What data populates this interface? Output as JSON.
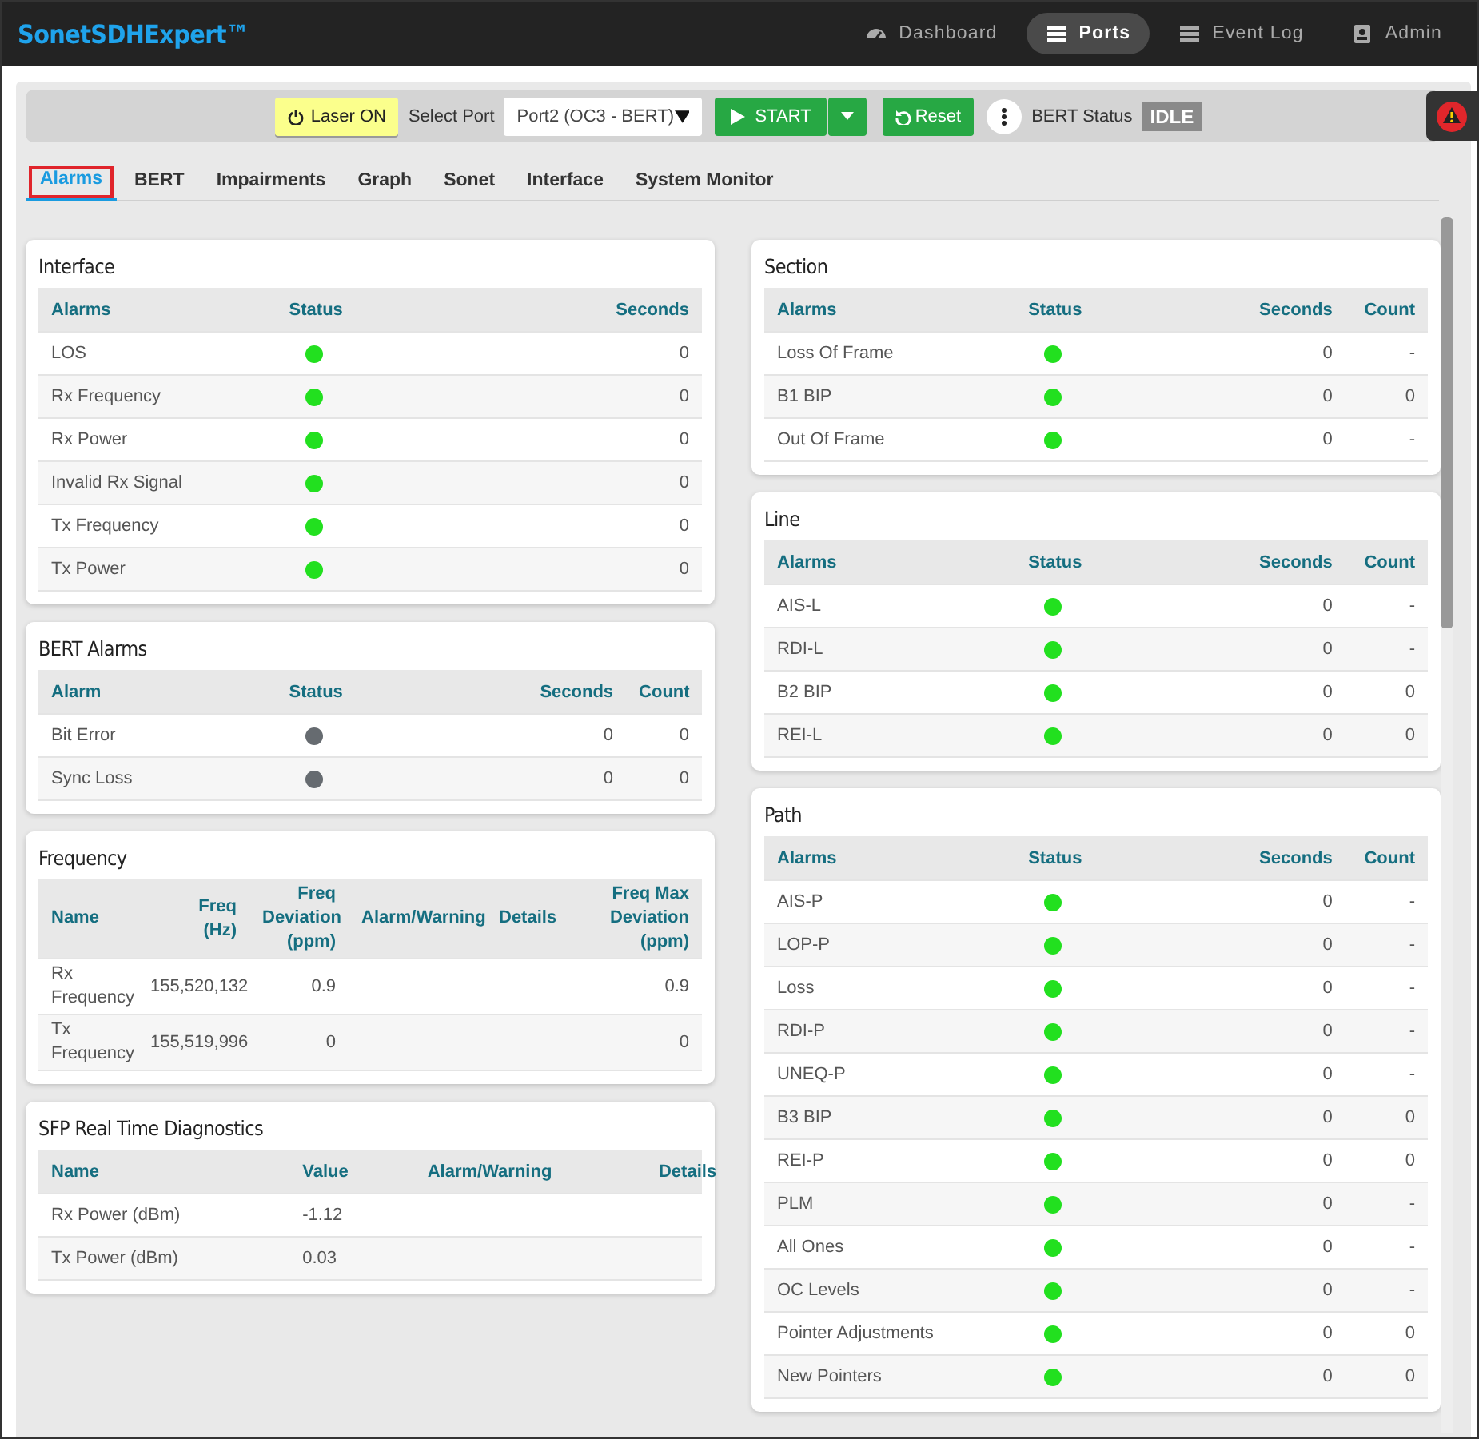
{
  "app": {
    "title": "SonetSDHExpert™"
  },
  "nav": [
    {
      "label": "Dashboard",
      "selected": false
    },
    {
      "label": "Ports",
      "selected": true
    },
    {
      "label": "Event Log",
      "selected": false
    },
    {
      "label": "Admin",
      "selected": false
    }
  ],
  "toolbar": {
    "laser_button": "Laser ON",
    "select_label": "Select Port",
    "port_select": "Port2 (OC3 - BERT)",
    "start_button": "START",
    "reset_button": "Reset",
    "status_label": "BERT Status",
    "status_value": "IDLE"
  },
  "tabs": [
    {
      "label": "Alarms",
      "selected": true
    },
    {
      "label": "BERT",
      "selected": false
    },
    {
      "label": "Impairments",
      "selected": false
    },
    {
      "label": "Graph",
      "selected": false
    },
    {
      "label": "Sonet",
      "selected": false
    },
    {
      "label": "Interface",
      "selected": false
    },
    {
      "label": "System Monitor",
      "selected": false
    }
  ],
  "left_column": [
    {
      "title": "Interface",
      "kind": "alarms3",
      "columns": [
        "Alarms",
        "Status",
        "Seconds"
      ],
      "rows": [
        {
          "name": "LOS",
          "color": "#22e01f",
          "seconds": "0"
        },
        {
          "name": "Rx Frequency",
          "color": "#22e01f",
          "seconds": "0"
        },
        {
          "name": "Rx Power",
          "color": "#22e01f",
          "seconds": "0"
        },
        {
          "name": "Invalid Rx Signal",
          "color": "#22e01f",
          "seconds": "0"
        },
        {
          "name": "Tx Frequency",
          "color": "#22e01f",
          "seconds": "0"
        },
        {
          "name": "Tx Power",
          "color": "#22e01f",
          "seconds": "0"
        }
      ]
    },
    {
      "title": "BERT Alarms",
      "kind": "alarms4",
      "columns": [
        "Alarm",
        "Status",
        "Seconds",
        "Count"
      ],
      "rows": [
        {
          "name": "Bit Error",
          "color": "#666b70",
          "seconds": "0",
          "count": "0"
        },
        {
          "name": "Sync Loss",
          "color": "#666b70",
          "seconds": "0",
          "count": "0"
        }
      ]
    },
    {
      "title": "Frequency",
      "kind": "frequency",
      "columns": [
        "Name",
        "Freq (Hz)",
        "Freq Deviation (ppm)",
        "Alarm/Warning",
        "Details",
        "Freq Max Deviation (ppm)"
      ],
      "rows": [
        {
          "name": "Rx Frequency",
          "freq": "155,520,132",
          "deviation": "0.9",
          "max_deviation": "0.9"
        },
        {
          "name": "Tx Frequency",
          "freq": "155,519,996",
          "deviation": "0",
          "max_deviation": "0"
        }
      ]
    },
    {
      "title": "SFP Real Time Diagnostics",
      "kind": "diagnostics",
      "columns": [
        "Name",
        "Value",
        "Alarm/Warning",
        "Details"
      ],
      "rows": [
        {
          "name": "Rx Power (dBm)",
          "value": "-1.12"
        },
        {
          "name": "Tx Power (dBm)",
          "value": "0.03"
        }
      ]
    }
  ],
  "right_column": [
    {
      "title": "Section",
      "kind": "alarms4",
      "columns": [
        "Alarms",
        "Status",
        "Seconds",
        "Count"
      ],
      "rows": [
        {
          "name": "Loss Of Frame",
          "color": "#22e01f",
          "seconds": "0",
          "count": "-"
        },
        {
          "name": "B1 BIP",
          "color": "#22e01f",
          "seconds": "0",
          "count": "0"
        },
        {
          "name": "Out Of Frame",
          "color": "#22e01f",
          "seconds": "0",
          "count": "-"
        }
      ]
    },
    {
      "title": "Line",
      "kind": "alarms4",
      "columns": [
        "Alarms",
        "Status",
        "Seconds",
        "Count"
      ],
      "rows": [
        {
          "name": "AIS-L",
          "color": "#22e01f",
          "seconds": "0",
          "count": "-"
        },
        {
          "name": "RDI-L",
          "color": "#22e01f",
          "seconds": "0",
          "count": "-"
        },
        {
          "name": "B2 BIP",
          "color": "#22e01f",
          "seconds": "0",
          "count": "0"
        },
        {
          "name": "REI-L",
          "color": "#22e01f",
          "seconds": "0",
          "count": "0"
        }
      ]
    },
    {
      "title": "Path",
      "kind": "alarms4",
      "columns": [
        "Alarms",
        "Status",
        "Seconds",
        "Count"
      ],
      "rows": [
        {
          "name": "AIS-P",
          "color": "#22e01f",
          "seconds": "0",
          "count": "-"
        },
        {
          "name": "LOP-P",
          "color": "#22e01f",
          "seconds": "0",
          "count": "-"
        },
        {
          "name": "Loss",
          "color": "#22e01f",
          "seconds": "0",
          "count": "-"
        },
        {
          "name": "RDI-P",
          "color": "#22e01f",
          "seconds": "0",
          "count": "-"
        },
        {
          "name": "UNEQ-P",
          "color": "#22e01f",
          "seconds": "0",
          "count": "-"
        },
        {
          "name": "B3 BIP",
          "color": "#22e01f",
          "seconds": "0",
          "count": "0"
        },
        {
          "name": "REI-P",
          "color": "#22e01f",
          "seconds": "0",
          "count": "0"
        },
        {
          "name": "PLM",
          "color": "#22e01f",
          "seconds": "0",
          "count": "-"
        },
        {
          "name": "All Ones",
          "color": "#22e01f",
          "seconds": "0",
          "count": "-"
        },
        {
          "name": "OC Levels",
          "color": "#22e01f",
          "seconds": "0",
          "count": "-"
        },
        {
          "name": "Pointer Adjustments",
          "color": "#22e01f",
          "seconds": "0",
          "count": "0"
        },
        {
          "name": "New Pointers",
          "color": "#22e01f",
          "seconds": "0",
          "count": "0"
        }
      ]
    }
  ]
}
